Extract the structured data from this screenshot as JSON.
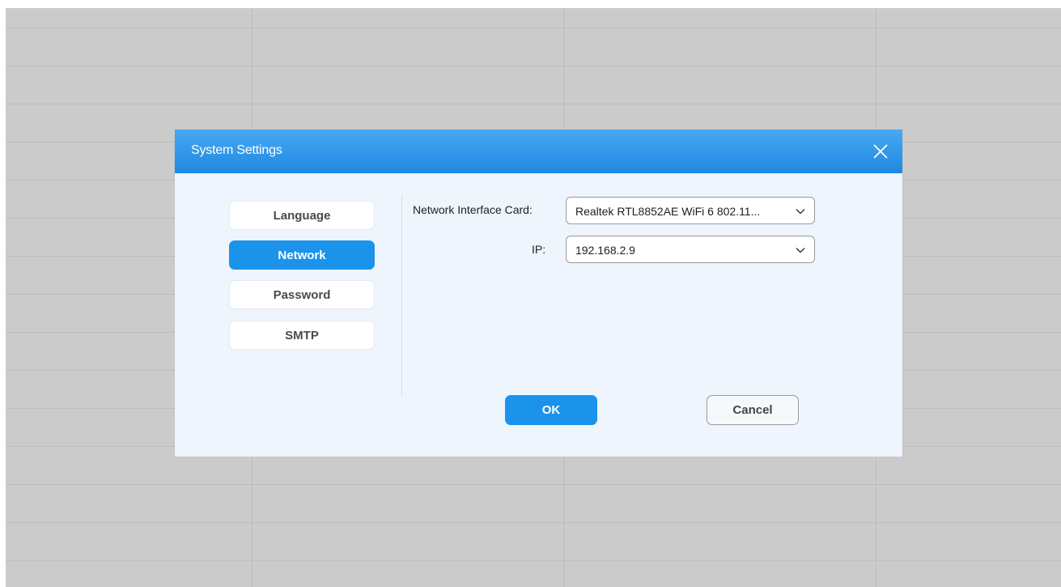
{
  "dialog": {
    "title": "System Settings",
    "close_icon": "close-icon"
  },
  "nav": {
    "items": [
      {
        "label": "Language",
        "active": false
      },
      {
        "label": "Network",
        "active": true
      },
      {
        "label": "Password",
        "active": false
      },
      {
        "label": "SMTP",
        "active": false
      }
    ]
  },
  "network": {
    "nic_label": "Network Interface Card:",
    "nic_value": "Realtek RTL8852AE WiFi 6 802.11...",
    "ip_label": "IP:",
    "ip_value": "192.168.2.9",
    "dropdown_icon": "chevron-down-icon"
  },
  "actions": {
    "ok_label": "OK",
    "cancel_label": "Cancel"
  },
  "colors": {
    "accent": "#1c93ea",
    "titlebar_top": "#4aa8f0",
    "titlebar_bottom": "#1e88e2",
    "dialog_bg": "#eef5fd",
    "backdrop": "#cbcbcb"
  }
}
